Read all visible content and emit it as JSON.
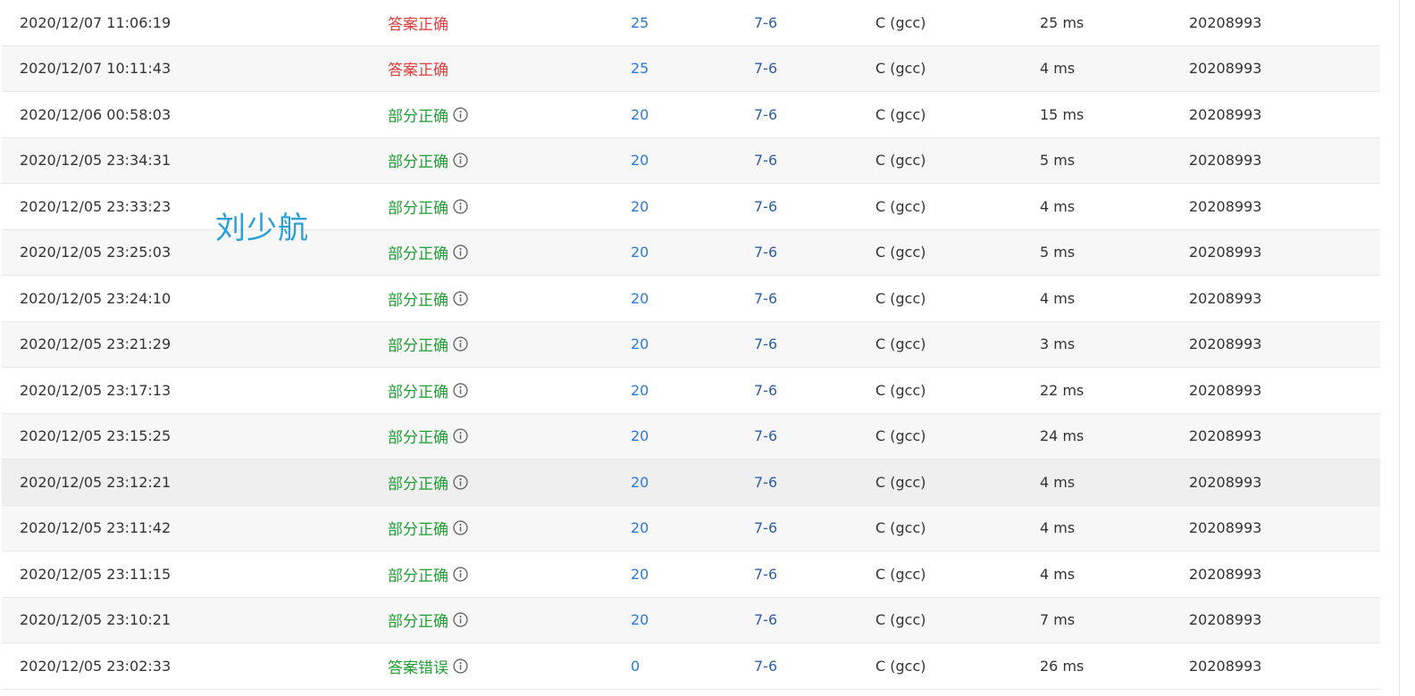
{
  "colors": {
    "status_correct": "#e03e3e",
    "status_partial": "#1f9e34",
    "score_link": "#2d7ad6",
    "problem_link": "#2d5ea8",
    "watermark": "#2a9fd8"
  },
  "watermark_text": "刘少航",
  "rows": [
    {
      "time": "2020/12/07 11:06:19",
      "status": "答案正确",
      "score": "25",
      "problem": "7-6",
      "lang": "C (gcc)",
      "time_used": "25 ms",
      "user": "20208993"
    },
    {
      "time": "2020/12/07 10:11:43",
      "status": "答案正确",
      "score": "25",
      "problem": "7-6",
      "lang": "C (gcc)",
      "time_used": "4 ms",
      "user": "20208993"
    },
    {
      "time": "2020/12/06 00:58:03",
      "status": "部分正确",
      "score": "20",
      "problem": "7-6",
      "lang": "C (gcc)",
      "time_used": "15 ms",
      "user": "20208993"
    },
    {
      "time": "2020/12/05 23:34:31",
      "status": "部分正确",
      "score": "20",
      "problem": "7-6",
      "lang": "C (gcc)",
      "time_used": "5 ms",
      "user": "20208993"
    },
    {
      "time": "2020/12/05 23:33:23",
      "status": "部分正确",
      "score": "20",
      "problem": "7-6",
      "lang": "C (gcc)",
      "time_used": "4 ms",
      "user": "20208993"
    },
    {
      "time": "2020/12/05 23:25:03",
      "status": "部分正确",
      "score": "20",
      "problem": "7-6",
      "lang": "C (gcc)",
      "time_used": "5 ms",
      "user": "20208993"
    },
    {
      "time": "2020/12/05 23:24:10",
      "status": "部分正确",
      "score": "20",
      "problem": "7-6",
      "lang": "C (gcc)",
      "time_used": "4 ms",
      "user": "20208993"
    },
    {
      "time": "2020/12/05 23:21:29",
      "status": "部分正确",
      "score": "20",
      "problem": "7-6",
      "lang": "C (gcc)",
      "time_used": "3 ms",
      "user": "20208993"
    },
    {
      "time": "2020/12/05 23:17:13",
      "status": "部分正确",
      "score": "20",
      "problem": "7-6",
      "lang": "C (gcc)",
      "time_used": "22 ms",
      "user": "20208993"
    },
    {
      "time": "2020/12/05 23:15:25",
      "status": "部分正确",
      "score": "20",
      "problem": "7-6",
      "lang": "C (gcc)",
      "time_used": "24 ms",
      "user": "20208993"
    },
    {
      "time": "2020/12/05 23:12:21",
      "status": "部分正确",
      "score": "20",
      "problem": "7-6",
      "lang": "C (gcc)",
      "time_used": "4 ms",
      "user": "20208993"
    },
    {
      "time": "2020/12/05 23:11:42",
      "status": "部分正确",
      "score": "20",
      "problem": "7-6",
      "lang": "C (gcc)",
      "time_used": "4 ms",
      "user": "20208993"
    },
    {
      "time": "2020/12/05 23:11:15",
      "status": "部分正确",
      "score": "20",
      "problem": "7-6",
      "lang": "C (gcc)",
      "time_used": "4 ms",
      "user": "20208993"
    },
    {
      "time": "2020/12/05 23:10:21",
      "status": "部分正确",
      "score": "20",
      "problem": "7-6",
      "lang": "C (gcc)",
      "time_used": "7 ms",
      "user": "20208993"
    },
    {
      "time": "2020/12/05 23:02:33",
      "status": "答案错误",
      "score": "0",
      "problem": "7-6",
      "lang": "C (gcc)",
      "time_used": "26 ms",
      "user": "20208993"
    }
  ]
}
